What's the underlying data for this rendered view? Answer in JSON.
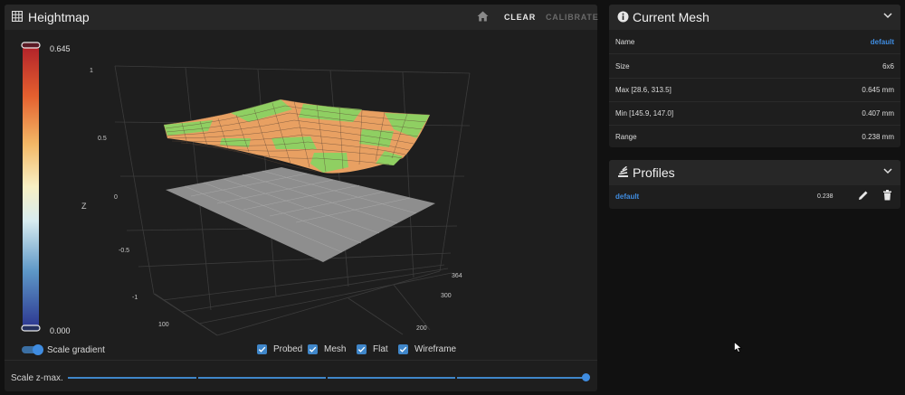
{
  "heightmap": {
    "title": "Heightmap",
    "clear_label": "CLEAR",
    "calibrate_label": "CALIBRATE",
    "scale_max": "0.645",
    "scale_min": "0.000",
    "z_axis_label": "Z",
    "z_ticks": [
      "1",
      "0.5",
      "0",
      "-0.5",
      "-1"
    ],
    "x_ticks": [
      "100"
    ],
    "y_ticks": [
      "364",
      "300",
      "200"
    ],
    "scale_gradient_label": "Scale gradient",
    "checkboxes": [
      {
        "label": "Probed",
        "checked": true
      },
      {
        "label": "Mesh",
        "checked": true
      },
      {
        "label": "Flat",
        "checked": true
      },
      {
        "label": "Wireframe",
        "checked": true
      }
    ],
    "scale_zmax_label": "Scale z-max.",
    "scale_zmax_level": 1.0
  },
  "current_mesh": {
    "title": "Current Mesh",
    "rows": [
      {
        "key": "Name",
        "value": "default",
        "link": true
      },
      {
        "key": "Size",
        "value": "6x6",
        "link": false
      },
      {
        "key": "Max [28.6, 313.5]",
        "value": "0.645 mm",
        "link": false
      },
      {
        "key": "Min [145.9, 147.0]",
        "value": "0.407 mm",
        "link": false
      },
      {
        "key": "Range",
        "value": "0.238 mm",
        "link": false
      }
    ]
  },
  "profiles": {
    "title": "Profiles",
    "items": [
      {
        "name": "default",
        "range": "0.238"
      }
    ]
  },
  "colors": {
    "accent": "#3f8ce0",
    "panel": "#1e1e1e",
    "header": "#272727",
    "mesh_green": "#8fcf62",
    "mesh_orange": "#e8a062",
    "flat_gray": "#8e8e8e"
  }
}
